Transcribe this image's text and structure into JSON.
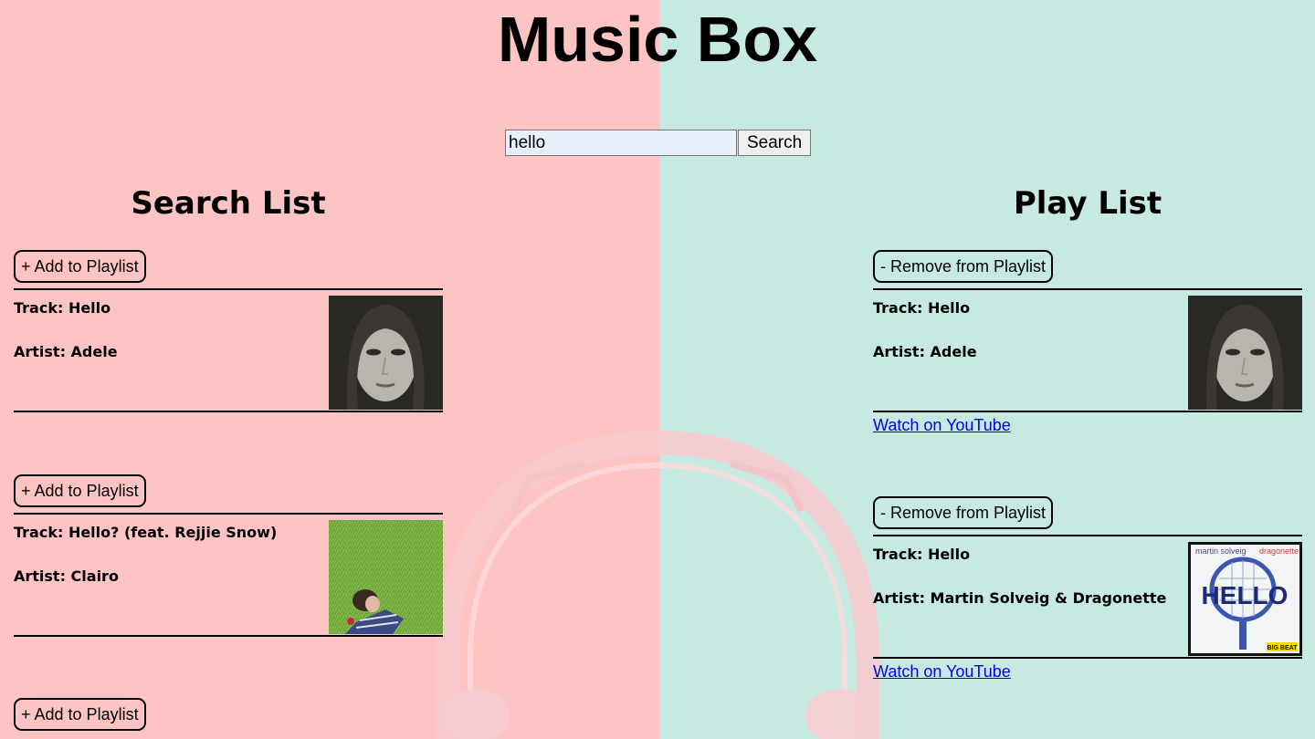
{
  "app": {
    "title": "Music Box"
  },
  "search": {
    "value": "hello",
    "button_label": "Search"
  },
  "search_list": {
    "title": "Search List",
    "items": [
      {
        "action_label": "+ Add to Playlist",
        "track": "Track: Hello",
        "artist": "Artist: Adele",
        "art_icon": "portrait-cover-icon"
      },
      {
        "action_label": "+ Add to Playlist",
        "track": "Track: Hello? (feat. Rejjie Snow)",
        "artist": "Artist: Clairo",
        "art_icon": "grass-cover-icon"
      },
      {
        "action_label": "+ Add to Playlist"
      }
    ]
  },
  "play_list": {
    "title": "Play List",
    "items": [
      {
        "action_label": "- Remove from Playlist",
        "track": "Track: Hello",
        "artist": "Artist: Adele",
        "link_label": "Watch on YouTube",
        "art_icon": "portrait-cover-icon"
      },
      {
        "action_label": "- Remove from Playlist",
        "track": "Track: Hello",
        "artist": "Artist: Martin Solveig & Dragonette",
        "link_label": "Watch on YouTube",
        "art_icon": "hello-racket-cover-icon",
        "art_text": {
          "artist_line_1": "martin solveig",
          "artist_line_2": "dragonette",
          "big_word": "HELLO",
          "label_badge": "BIG BEAT"
        }
      }
    ]
  },
  "colors": {
    "left_bg": "#fdc4c3",
    "right_bg": "#c6e9e2",
    "link": "#0000ee"
  }
}
